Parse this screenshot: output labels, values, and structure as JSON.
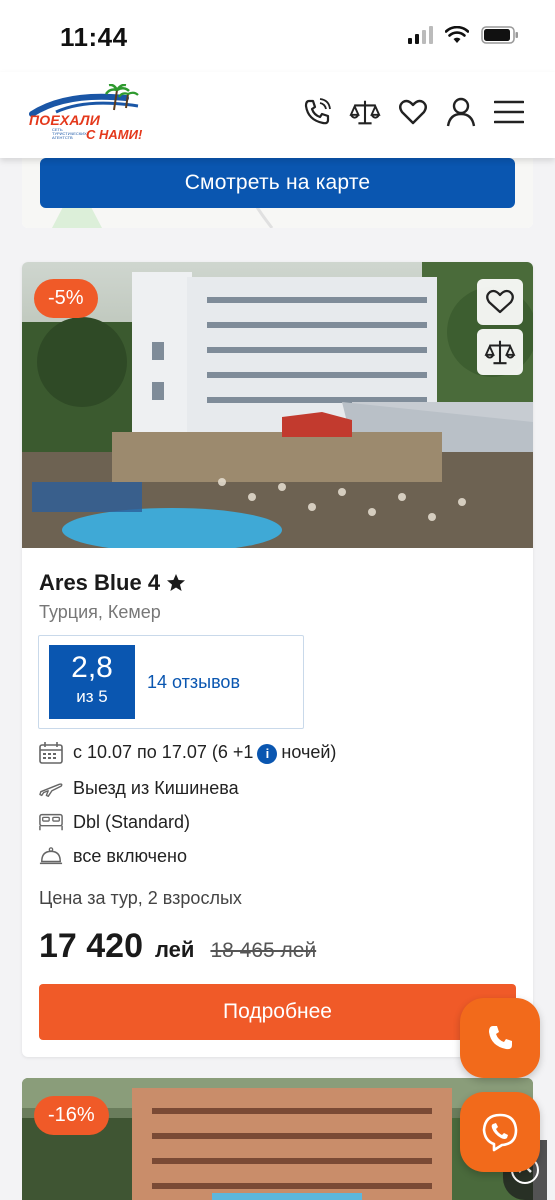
{
  "status_bar": {
    "time": "11:44"
  },
  "header": {
    "logo_line1": "ПОЕХАЛИ",
    "logo_line2": "С НАМИ!",
    "logo_small": "СЕТЬ ТУРИСТИЧЕСКИХ АГЕНТСТВ",
    "icons": [
      "phone-icon",
      "compare-icon",
      "heart-icon",
      "user-icon",
      "menu-icon"
    ]
  },
  "map": {
    "button_label": "Смотреть на карте"
  },
  "hotel": {
    "discount": "-5%",
    "name": "Ares Blue 4",
    "location": "Турция, Кемер",
    "rating": {
      "score": "2,8",
      "out_of": "из 5",
      "reviews": "14 отзывов"
    },
    "dates_prefix": "с 10.07 по 17.07 (6 +1",
    "dates_info": "i",
    "dates_suffix": "ночей)",
    "departure": "Выезд из Кишинева",
    "room": "Dbl (Standard)",
    "meal": "все включено",
    "price_label": "Цена за тур, 2 взрослых",
    "price": "17 420",
    "currency": "лей",
    "old_price": "18 465 лей",
    "details_button": "Подробнее"
  },
  "hotel2": {
    "discount": "-16%"
  },
  "colors": {
    "brand_blue": "#0a56b0",
    "accent_orange": "#f05a28"
  }
}
